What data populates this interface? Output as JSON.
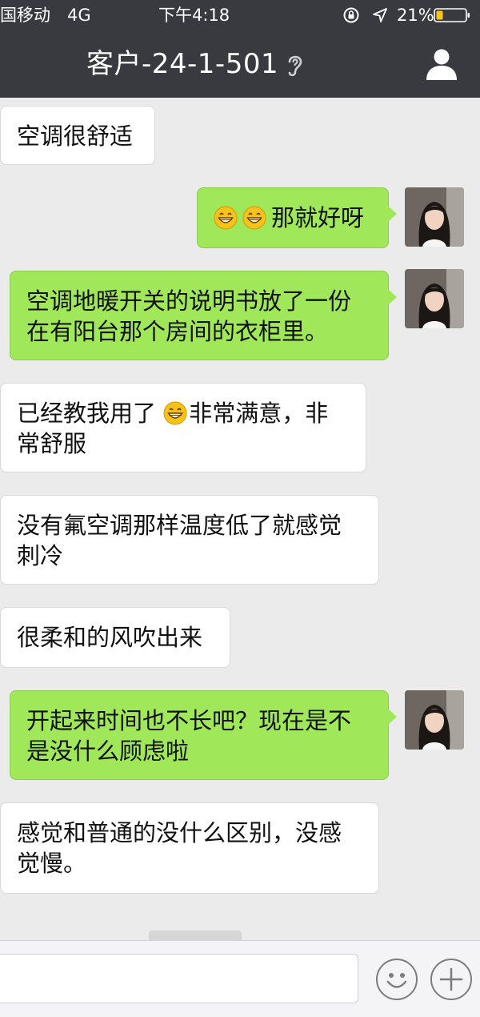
{
  "status_bar": {
    "carrier": "国移动",
    "network": "4G",
    "time": "下午4:18",
    "battery_percent": "21%",
    "icons": [
      "orientation-lock-icon",
      "location-icon",
      "battery-icon"
    ]
  },
  "nav": {
    "title": "客户-24-1-501",
    "icons": [
      "ear-icon",
      "profile-icon"
    ]
  },
  "messages": [
    {
      "side": "incoming",
      "lines": [
        "空调很舒适"
      ]
    },
    {
      "side": "outgoing",
      "emoji_count": 2,
      "lines": [
        "那就好呀"
      ]
    },
    {
      "side": "outgoing",
      "lines": [
        "空调地暖开关的说明书放了一份",
        "在有阳台那个房间的衣柜里。"
      ]
    },
    {
      "side": "incoming",
      "lines": [
        "已经教我用了",
        "非常满意，非",
        "常舒服"
      ]
    },
    {
      "side": "incoming",
      "lines": [
        "没有氟空调那样温度低了就感觉",
        "刺冷"
      ]
    },
    {
      "side": "incoming",
      "lines": [
        "很柔和的风吹出来"
      ]
    },
    {
      "side": "outgoing",
      "lines": [
        "开起来时间也不长吧？现在是不",
        "是没什么顾虑啦"
      ]
    },
    {
      "side": "incoming",
      "lines": [
        "感觉和普通的没什么区别，没感",
        "觉慢。"
      ]
    }
  ],
  "colors": {
    "header_bg": "#393a3f",
    "chat_bg": "#ebebeb",
    "outgoing_bubble": "#a0e75a",
    "incoming_bubble": "#ffffff"
  },
  "input_bar": {
    "icons": [
      "emoji-icon",
      "plus-icon"
    ]
  }
}
